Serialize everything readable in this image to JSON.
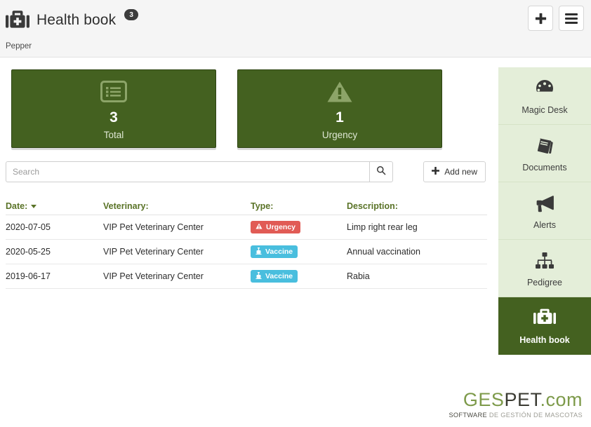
{
  "header": {
    "icon": "medical-bag-icon",
    "title": "Health book",
    "badge": "3",
    "subtitle": "Pepper",
    "add_button_icon": "plus-icon",
    "menu_button_icon": "hamburger-menu-icon"
  },
  "cards": [
    {
      "icon": "list-icon",
      "value": "3",
      "label": "Total"
    },
    {
      "icon": "warning-triangle-icon",
      "value": "1",
      "label": "Urgency"
    }
  ],
  "search": {
    "placeholder": "Search",
    "value": "",
    "button_icon": "search-icon"
  },
  "toolbar": {
    "add_new_label": "Add new",
    "add_new_icon": "plus-icon"
  },
  "table": {
    "columns": [
      "Date:",
      "Veterinary:",
      "Type:",
      "Description:"
    ],
    "sort_column": "Date:",
    "sort_direction": "desc",
    "rows": [
      {
        "date": "2020-07-05",
        "veterinary": "VIP Pet Veterinary Center",
        "type": "Urgency",
        "type_kind": "urgency",
        "type_icon": "warning-triangle-icon",
        "description": "Limp right rear leg"
      },
      {
        "date": "2020-05-25",
        "veterinary": "VIP Pet Veterinary Center",
        "type": "Vaccine",
        "type_kind": "vaccine",
        "type_icon": "syringe-icon",
        "description": "Annual vaccination"
      },
      {
        "date": "2019-06-17",
        "veterinary": "VIP Pet Veterinary Center",
        "type": "Vaccine",
        "type_kind": "vaccine",
        "type_icon": "syringe-icon",
        "description": "Rabia"
      }
    ]
  },
  "sidebar": {
    "items": [
      {
        "label": "Magic Desk",
        "icon": "dashboard-gauge-icon",
        "active": false
      },
      {
        "label": "Documents",
        "icon": "book-icon",
        "active": false
      },
      {
        "label": "Alerts",
        "icon": "megaphone-icon",
        "active": false
      },
      {
        "label": "Pedigree",
        "icon": "sitemap-icon",
        "active": false
      },
      {
        "label": "Health book",
        "icon": "medical-bag-icon",
        "active": true
      }
    ]
  },
  "logo": {
    "part1": "GES",
    "part2": "PET",
    "part3": ".com",
    "tagline1": "SOFTWARE",
    "tagline2": "DE GESTIÓN DE MASCOTAS"
  },
  "colors": {
    "accent_green": "#446120",
    "sidebar_green": "#e4eed9",
    "header_green_text": "#5a7327",
    "urgency_red": "#e15b55",
    "vaccine_blue": "#49bede"
  }
}
